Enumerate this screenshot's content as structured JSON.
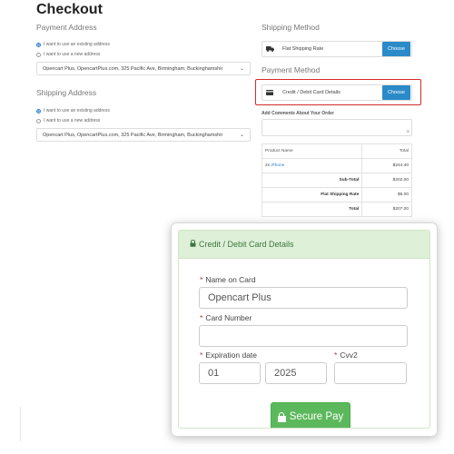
{
  "page": {
    "title": "Checkout"
  },
  "payment_address": {
    "heading": "Payment Address",
    "options": [
      "I want to use an existing address",
      "I want to use a new address"
    ],
    "selected_address": "Opencart Plus, OpencartPlus.com, 325 Pacific Ave, Birmingham, Buckinghamshir"
  },
  "shipping_address": {
    "heading": "Shipping Address",
    "options": [
      "I want to use an existing address",
      "I want to use a new address"
    ],
    "selected_address": "Opencart Plus, OpencartPlus.com, 325 Pacific Ave, Birmingham, Buckinghamshir"
  },
  "shipping_method": {
    "heading": "Shipping Method",
    "label": "Flat Shipping Rate",
    "choose_label": "Choose",
    "icon": "truck-icon"
  },
  "payment_method": {
    "heading": "Payment Method",
    "label": "Credit / Debit Card Details",
    "choose_label": "Choose",
    "icon": "credit-card-icon",
    "highlight_color": "#d42a2a"
  },
  "comments": {
    "label": "Add Comments About Your Order"
  },
  "order": {
    "headers": [
      "Product Name",
      "Total"
    ],
    "item": {
      "qty": "2x",
      "name": "iPhone",
      "total": "$244.40"
    },
    "totals": [
      {
        "label": "Sub-Total",
        "value": "$202.00"
      },
      {
        "label": "Flat Shipping Rate",
        "value": "$5.00"
      },
      {
        "label": "Total",
        "value": "$207.00"
      }
    ]
  },
  "card_form": {
    "title": "Credit / Debit Card Details",
    "name_label": "Name on Card",
    "name_value": "Opencart Plus",
    "number_label": "Card Number",
    "number_value": "",
    "expiration_label": "Expiration date",
    "exp_month": "01",
    "exp_year": "2025",
    "cvv_label": "Cvv2",
    "cvv_value": "",
    "required_mark": "*",
    "submit_label": "Secure Pay",
    "colors": {
      "header_bg": "#def0d8",
      "header_text": "#3c763d",
      "button_bg": "#5cb85c",
      "required": "#c9302c"
    }
  },
  "colors": {
    "accent": "#2a8bc8"
  }
}
